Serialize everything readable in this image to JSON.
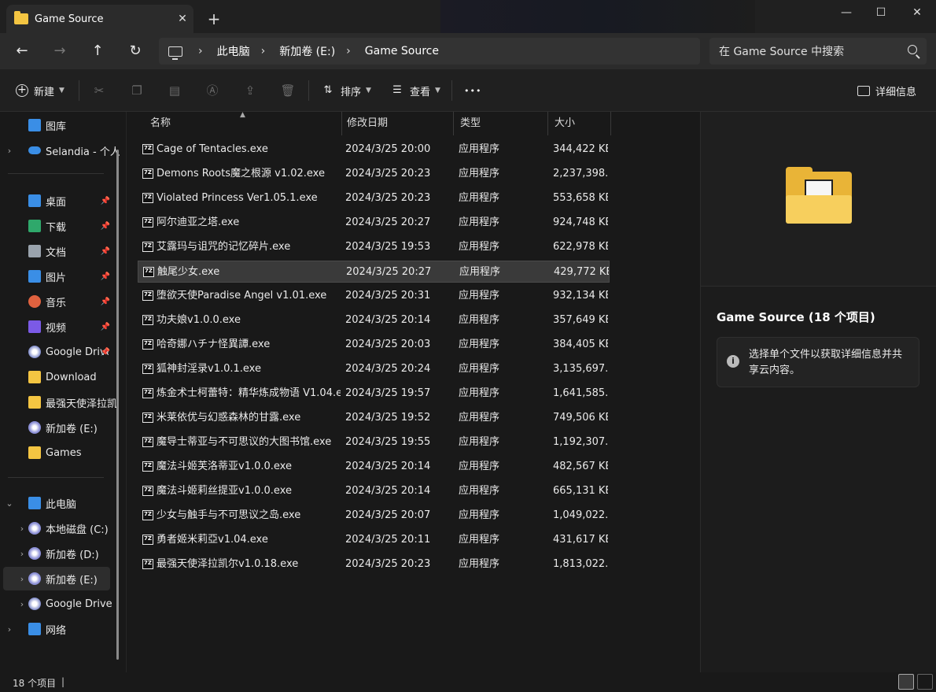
{
  "tab": {
    "title": "Game Source",
    "close": "✕",
    "new": "+"
  },
  "window": {
    "minimize": "—",
    "maximize": "☐",
    "close": "✕"
  },
  "nav": {
    "back": "←",
    "forward": "→",
    "up": "↑",
    "refresh": "↻"
  },
  "breadcrumb": [
    "此电脑",
    "新加卷 (E:)",
    "Game Source"
  ],
  "search": {
    "placeholder": "在 Game Source 中搜索"
  },
  "toolbar": {
    "new_label": "新建",
    "sort_label": "排序",
    "view_label": "查看",
    "more": "•••",
    "details_label": "详细信息"
  },
  "sidebar": {
    "items": [
      {
        "label": "图库",
        "icon": "gallery-icon"
      },
      {
        "label": "Selandia - 个人",
        "icon": "onedrive-icon"
      },
      {
        "label": "桌面",
        "icon": "desktop-icon"
      },
      {
        "label": "下载",
        "icon": "download-icon"
      },
      {
        "label": "文档",
        "icon": "document-icon"
      },
      {
        "label": "图片",
        "icon": "pictures-icon"
      },
      {
        "label": "音乐",
        "icon": "music-icon"
      },
      {
        "label": "视频",
        "icon": "video-icon"
      },
      {
        "label": "Google Drive",
        "icon": "google-drive-icon"
      },
      {
        "label": "Download",
        "icon": "folder-icon"
      },
      {
        "label": "最强天使泽拉凯",
        "icon": "folder-icon"
      },
      {
        "label": "新加卷 (E:)",
        "icon": "drive-icon"
      },
      {
        "label": "Games",
        "icon": "folder-icon"
      },
      {
        "label": "此电脑",
        "icon": "this-pc-icon"
      },
      {
        "label": "本地磁盘 (C:)",
        "icon": "drive-icon"
      },
      {
        "label": "新加卷 (D:)",
        "icon": "drive-icon"
      },
      {
        "label": "新加卷 (E:)",
        "icon": "drive-icon"
      },
      {
        "label": "Google Drive",
        "icon": "google-drive-icon"
      },
      {
        "label": "网络",
        "icon": "network-icon"
      }
    ]
  },
  "columns": {
    "name": "名称",
    "date": "修改日期",
    "type": "类型",
    "size": "大小"
  },
  "files": [
    {
      "name": "Cage of Tentacles.exe",
      "date": "2024/3/25 20:00",
      "type": "应用程序",
      "size": "344,422 KB"
    },
    {
      "name": "Demons Roots魔之根源 v1.02.exe",
      "date": "2024/3/25 20:23",
      "type": "应用程序",
      "size": "2,237,398..."
    },
    {
      "name": "Violated Princess   Ver1.05.1.exe",
      "date": "2024/3/25 20:23",
      "type": "应用程序",
      "size": "553,658 KB"
    },
    {
      "name": "阿尔迪亚之塔.exe",
      "date": "2024/3/25 20:27",
      "type": "应用程序",
      "size": "924,748 KB"
    },
    {
      "name": "艾露玛与诅咒的记忆碎片.exe",
      "date": "2024/3/25 19:53",
      "type": "应用程序",
      "size": "622,978 KB"
    },
    {
      "name": "触尾少女.exe",
      "date": "2024/3/25 20:27",
      "type": "应用程序",
      "size": "429,772 KB"
    },
    {
      "name": "堕欲天使Paradise Angel v1.01.exe",
      "date": "2024/3/25 20:31",
      "type": "应用程序",
      "size": "932,134 KB"
    },
    {
      "name": "功夫娘v1.0.0.exe",
      "date": "2024/3/25 20:14",
      "type": "应用程序",
      "size": "357,649 KB"
    },
    {
      "name": "哈奇娜ハチナ怪異譚.exe",
      "date": "2024/3/25 20:03",
      "type": "应用程序",
      "size": "384,405 KB"
    },
    {
      "name": "狐神封淫录v1.0.1.exe",
      "date": "2024/3/25 20:24",
      "type": "应用程序",
      "size": "3,135,697..."
    },
    {
      "name": "炼金术士柯蕾特：精华炼成物语 V1.04.e...",
      "date": "2024/3/25 19:57",
      "type": "应用程序",
      "size": "1,641,585..."
    },
    {
      "name": "米莱依优与幻惑森林的甘露.exe",
      "date": "2024/3/25 19:52",
      "type": "应用程序",
      "size": "749,506 KB"
    },
    {
      "name": "魔导士蒂亚与不可思议的大图书馆.exe",
      "date": "2024/3/25 19:55",
      "type": "应用程序",
      "size": "1,192,307..."
    },
    {
      "name": "魔法斗姬芙洛蒂亚v1.0.0.exe",
      "date": "2024/3/25 20:14",
      "type": "应用程序",
      "size": "482,567 KB"
    },
    {
      "name": "魔法斗姬莉丝提亚v1.0.0.exe",
      "date": "2024/3/25 20:14",
      "type": "应用程序",
      "size": "665,131 KB"
    },
    {
      "name": "少女与触手与不可思议之岛.exe",
      "date": "2024/3/25 20:07",
      "type": "应用程序",
      "size": "1,049,022..."
    },
    {
      "name": "勇者姬米莉亞v1.04.exe",
      "date": "2024/3/25 20:11",
      "type": "应用程序",
      "size": "431,617 KB"
    },
    {
      "name": "最强天使泽拉凯尔v1.0.18.exe",
      "date": "2024/3/25 20:23",
      "type": "应用程序",
      "size": "1,813,022..."
    }
  ],
  "details": {
    "title": "Game Source (18 个项目)",
    "info_text": "选择单个文件以获取详细信息并共享云内容。"
  },
  "status": {
    "count": "18 个项目",
    "separator": "|"
  }
}
